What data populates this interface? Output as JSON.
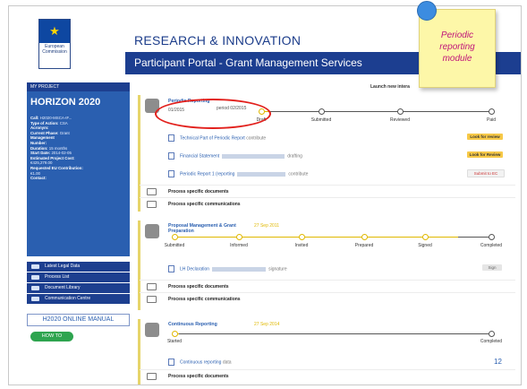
{
  "header": {
    "ec_label": "European Commission",
    "title": "RESEARCH & INNOVATION",
    "subtitle": "Participant Portal - Grant Management Services"
  },
  "sidebar": {
    "section_label": "MY PROJECT",
    "brand": "HORIZON 2020",
    "info": [
      {
        "k": "Call:",
        "v": "H2020-MSCA-IF..."
      },
      {
        "k": "Type of Action:",
        "v": "CSA"
      },
      {
        "k": "Acronym:",
        "v": ""
      },
      {
        "k": "",
        "v": ""
      },
      {
        "k": "Current Phase:",
        "v": "Grant"
      },
      {
        "k": "Management",
        "v": ""
      },
      {
        "k": "Number:",
        "v": ""
      },
      {
        "k": "Duration:",
        "v": "15 months"
      },
      {
        "k": "Start Date:",
        "v": "2014-02-05"
      },
      {
        "k": "Estimated Project Cost:",
        "v": ""
      },
      {
        "k": "",
        "v": "€425,279.00"
      },
      {
        "k": "Requested EU Contribution:",
        "v": ""
      },
      {
        "k": "",
        "v": "€1.00"
      },
      {
        "k": "Contact:",
        "v": ""
      }
    ],
    "links": [
      "Latest Legal Data",
      "Process List",
      "Document Library",
      "Communication Centre"
    ],
    "manual": "H2020 ONLINE MANUAL",
    "howto": "HOW TO"
  },
  "main": {
    "launch": "Launch new intera",
    "periodic": {
      "title": "Periodic Reporting",
      "period": "period 02/2015",
      "date_left": "01/2015",
      "steps": [
        "Draft",
        "Submitted",
        "Reviewed",
        "Paid"
      ],
      "docs": [
        {
          "name": "Technical Part of Periodic Report",
          "status": "contribute",
          "action": "Look for review"
        },
        {
          "name": "Financial Statement",
          "status": "drafting",
          "action": "Look for Review"
        },
        {
          "name": "Periodic Report 1 (reporting",
          "status": "contribute",
          "action": "Submit to EC"
        }
      ]
    },
    "process_docs": "Process specific documents",
    "process_comms": "Process specific communications",
    "pmgp": {
      "title": "Proposal Management & Grant Preparation",
      "date_tag": "27 Sep 2011",
      "steps": [
        "Submitted",
        "Informed",
        "Invited",
        "Prepared",
        "Signed",
        "Completed"
      ],
      "docs": [
        {
          "name": "LH Declaration",
          "status": "signature",
          "action": "Sign"
        }
      ]
    },
    "continuous": {
      "title": "Continuous Reporting",
      "date_tag": "27 Sep 2014",
      "steps": [
        "Started",
        "Completed"
      ],
      "docs": [
        {
          "name": "Continuous reporting",
          "status": "data"
        }
      ]
    }
  },
  "annotation": {
    "note": "Periodic reporting module",
    "page": "12"
  },
  "colors": {
    "brand_blue": "#1c3e90",
    "sidebar_blue": "#2a5fb0",
    "highlight_red": "#e2201c",
    "note_yellow": "#fdf7a8",
    "accent_yellow": "#f7c948"
  }
}
